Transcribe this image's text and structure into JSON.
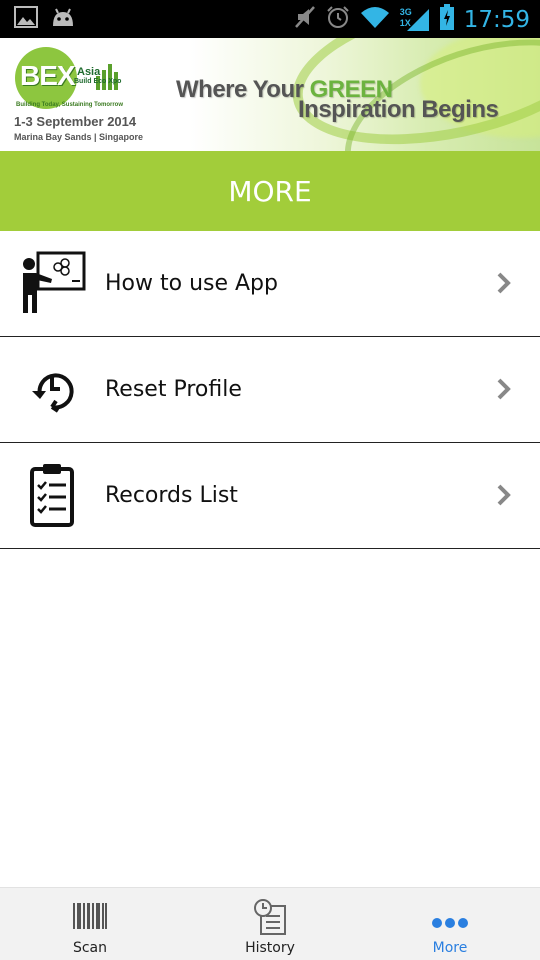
{
  "status_bar": {
    "time": "17:59",
    "network": "3G",
    "network_sub": "1X",
    "icons": [
      "gallery-icon",
      "android-icon",
      "mute-icon",
      "alarm-icon",
      "wifi-icon",
      "signal-icon",
      "battery-icon"
    ]
  },
  "banner": {
    "logo_text": "BEX",
    "logo_asia": "Asia",
    "logo_sub": "Build Eco Xpo",
    "tagline": "Building Today, Sustaining Tomorrow",
    "date": "1-3 September 2014",
    "venue": "Marina Bay Sands | Singapore",
    "slogan_part1": "Where Your ",
    "slogan_green": "GREEN",
    "slogan_part2": "Inspiration Begins"
  },
  "header": {
    "title": "MORE"
  },
  "menu": {
    "items": [
      {
        "label": "How to use App",
        "icon": "presentation-icon"
      },
      {
        "label": "Reset Profile",
        "icon": "reset-clock-icon"
      },
      {
        "label": "Records List",
        "icon": "clipboard-checklist-icon"
      }
    ]
  },
  "bottom_nav": {
    "items": [
      {
        "label": "Scan",
        "icon": "barcode-icon"
      },
      {
        "label": "History",
        "icon": "history-icon"
      },
      {
        "label": "More",
        "icon": "more-dots-icon",
        "active": true
      }
    ]
  },
  "colors": {
    "accent_green": "#a2cd3a",
    "active_blue": "#2a7fe0",
    "status_blue": "#33b5e5"
  }
}
